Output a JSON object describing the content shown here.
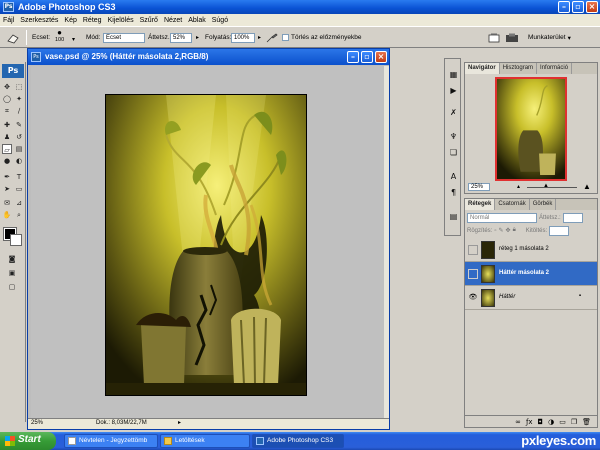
{
  "app": {
    "title": "Adobe Photoshop CS3",
    "logo": "Ps"
  },
  "menu": [
    "Fájl",
    "Szerkesztés",
    "Kép",
    "Réteg",
    "Kijelölés",
    "Szűrő",
    "Nézet",
    "Ablak",
    "Súgó"
  ],
  "options": {
    "brush_label": "Ecset:",
    "brush_size": "100",
    "mode_label": "Mód:",
    "mode_value": "Ecset",
    "opacity_label": "Áttetsz.:",
    "opacity_value": "52%",
    "flow_label": "Folyatás:",
    "flow_value": "100%",
    "erase_history_label": "Törlés az előzményekbe",
    "workspace_label": "Munkaterület"
  },
  "document": {
    "title": "vase.psd @ 25% (Háttér másolata 2,RGB/8)",
    "zoom": "25%",
    "doc_info": "Dok.: 8,03M/22,7M"
  },
  "navigator": {
    "tabs": [
      "Navigátor",
      "Hisztogram",
      "Információ"
    ],
    "zoom": "25%"
  },
  "layers_panel": {
    "tabs": [
      "Rétegek",
      "Csatornák",
      "Görbék"
    ],
    "blend_mode": "Normál",
    "opacity_label": "Áttetsz.:",
    "lock_label": "Rögzítés:",
    "fill_label": "Kitöltés:",
    "layers": [
      {
        "name": "réteg 1 másolata 2",
        "visible": false,
        "selected": false
      },
      {
        "name": "Háttér másolata 2",
        "visible": false,
        "selected": true
      },
      {
        "name": "Háttér",
        "visible": true,
        "selected": false
      }
    ]
  },
  "taskbar": {
    "start_label": "Start",
    "tasks": [
      "Névtelen - Jegyzettömb",
      "Letöltések",
      "Adobe Photoshop CS3"
    ]
  },
  "watermark": "pxleyes.com",
  "colors": {
    "titlebar": "#0a52d4",
    "selection": "#316ac5",
    "start": "#379c37"
  }
}
